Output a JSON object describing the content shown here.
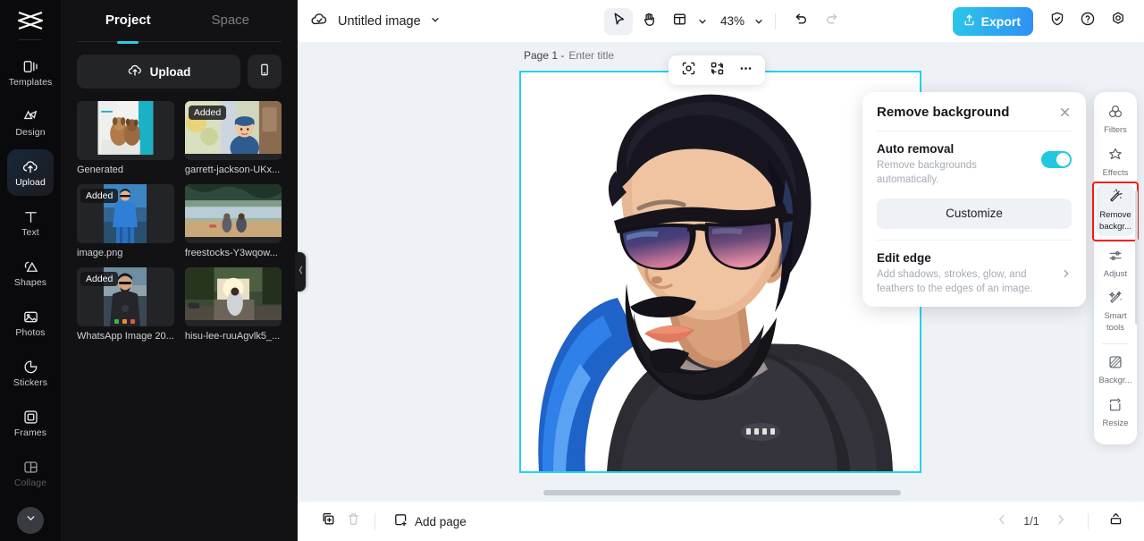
{
  "colors": {
    "accent_cyan": "#22c8dd",
    "export_gradient_start": "#2ac8e8",
    "export_gradient_end": "#2f8ff5",
    "selection_outline": "#22d3ee",
    "highlight_red": "#ff1a1a",
    "rail_bg": "#0a0a0c",
    "panel_bg": "#121214",
    "canvas_bg": "#eef1f5"
  },
  "rail": {
    "logo_name": "capcut-logo",
    "items": [
      {
        "label": "Templates",
        "icon": "templates-icon",
        "active": false
      },
      {
        "label": "Design",
        "icon": "design-icon",
        "active": false
      },
      {
        "label": "Upload",
        "icon": "upload-cloud-icon",
        "active": true
      },
      {
        "label": "Text",
        "icon": "text-icon",
        "active": false
      },
      {
        "label": "Shapes",
        "icon": "shapes-icon",
        "active": false
      },
      {
        "label": "Photos",
        "icon": "photos-icon",
        "active": false
      },
      {
        "label": "Stickers",
        "icon": "stickers-icon",
        "active": false
      },
      {
        "label": "Frames",
        "icon": "frames-icon",
        "active": false
      },
      {
        "label": "Collage",
        "icon": "collage-icon",
        "active": false
      }
    ],
    "collapse_icon": "chevron-down-icon"
  },
  "panel": {
    "tabs": [
      {
        "label": "Project",
        "active": true
      },
      {
        "label": "Space",
        "active": false
      }
    ],
    "upload_label": "Upload",
    "upload_icon": "upload-cloud-icon",
    "phone_icon": "mobile-phone-icon",
    "badge_added": "Added",
    "thumbnails": [
      {
        "label": "Generated",
        "added": false,
        "art": "dogs"
      },
      {
        "label": "garrett-jackson-UKx...",
        "added": true,
        "art": "boy"
      },
      {
        "label": "image.png",
        "added": true,
        "art": "man-blue"
      },
      {
        "label": "freestocks-Y3wqow...",
        "added": false,
        "art": "lake"
      },
      {
        "label": "WhatsApp Image 20...",
        "added": true,
        "art": "portrait"
      },
      {
        "label": "hisu-lee-ruuAgvlk5_...",
        "added": false,
        "art": "road"
      }
    ],
    "collapse_handle_icon": "chevron-left-icon"
  },
  "topbar": {
    "cloud_icon": "cloud-check-icon",
    "doc_name": "Untitled image",
    "doc_chevron_icon": "chevron-down-icon",
    "tools": [
      {
        "name": "select-tool",
        "icon": "cursor-arrow-icon",
        "active": true
      },
      {
        "name": "hand-tool",
        "icon": "hand-icon",
        "active": false
      },
      {
        "name": "layout-tool",
        "icon": "layout-panel-icon",
        "active": false
      }
    ],
    "layout_chevron_icon": "chevron-down-icon",
    "zoom_level": "43%",
    "zoom_chevron_icon": "chevron-down-icon",
    "undo_icon": "undo-arrow-icon",
    "redo_icon": "redo-arrow-icon",
    "export_label": "Export",
    "export_icon": "share-up-icon",
    "shield_icon": "shield-check-icon",
    "help_icon": "question-circle-icon",
    "settings_icon": "gear-icon"
  },
  "canvas": {
    "page_label": "Page 1 -",
    "page_title_placeholder": "Enter title",
    "page_title_value": "",
    "float_tools": [
      {
        "name": "crop-tool",
        "icon": "crop-frame-icon"
      },
      {
        "name": "replace-tool",
        "icon": "shuffle-swap-icon"
      },
      {
        "name": "more-tool",
        "icon": "ellipsis-icon"
      }
    ]
  },
  "remove_bg_panel": {
    "title": "Remove background",
    "close_icon": "close-icon",
    "auto_removal": {
      "title": "Auto removal",
      "subtitle": "Remove backgrounds automatically.",
      "toggle_on": true
    },
    "customize_label": "Customize",
    "edit_edge": {
      "title": "Edit edge",
      "subtitle": "Add shadows, strokes, glow, and feathers to the edges of an image.",
      "chevron_icon": "chevron-right-icon"
    }
  },
  "tool_rail": {
    "items": [
      {
        "label": "Filters",
        "icon": "filters-circles-icon",
        "selected": false,
        "highlighted": false
      },
      {
        "label": "Effects",
        "icon": "effects-star-icon",
        "selected": false,
        "highlighted": false
      },
      {
        "label": "Remove\nbackgr...",
        "label_line1": "Remove",
        "label_line2": "backgr...",
        "icon": "magic-wand-icon",
        "selected": true,
        "highlighted": true
      },
      {
        "label": "Adjust",
        "icon": "sliders-icon",
        "selected": false,
        "highlighted": false
      },
      {
        "label": "Smart\ntools",
        "label_line1": "Smart",
        "label_line2": "tools",
        "icon": "smart-wand-icon",
        "selected": false,
        "highlighted": false
      },
      {
        "label": "Backgr...",
        "icon": "background-icon",
        "selected": false,
        "highlighted": false
      },
      {
        "label": "Resize",
        "icon": "resize-icon",
        "selected": false,
        "highlighted": false
      }
    ]
  },
  "bottombar": {
    "duplicate_icon": "duplicate-page-icon",
    "delete_icon": "trash-icon",
    "add_page_label": "Add page",
    "add_page_icon": "add-page-icon",
    "prev_icon": "chevron-left-icon",
    "next_icon": "chevron-right-icon",
    "page_indicator": "1/1",
    "timeline_icon": "expand-panel-icon"
  }
}
